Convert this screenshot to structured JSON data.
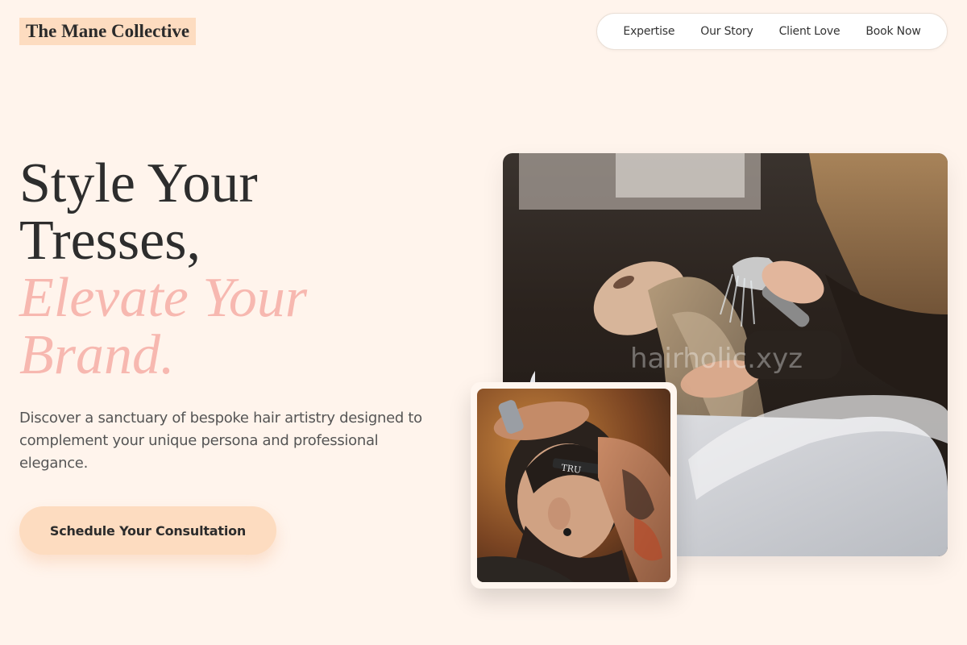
{
  "brand": {
    "name": "The Mane Collective"
  },
  "nav": {
    "items": [
      {
        "label": "Expertise"
      },
      {
        "label": "Our Story"
      },
      {
        "label": "Client Love"
      },
      {
        "label": "Book Now"
      }
    ]
  },
  "hero": {
    "headline_line1": "Style Your",
    "headline_line2": "Tresses,",
    "headline_accent1": "Elevate Your",
    "headline_accent2": "Brand.",
    "description": "Discover a sanctuary of bespoke hair artistry designed to complement your unique persona and professional elegance.",
    "cta_label": "Schedule Your Consultation"
  },
  "images": {
    "main": {
      "watermark": "hairholic.xyz"
    },
    "inset": {
      "razor_text": "TRU"
    }
  },
  "colors": {
    "background": "#fff4ec",
    "accent_peach": "#fddcc0",
    "accent_pink": "#f7b8b0",
    "text_dark": "#2d2d2d"
  }
}
